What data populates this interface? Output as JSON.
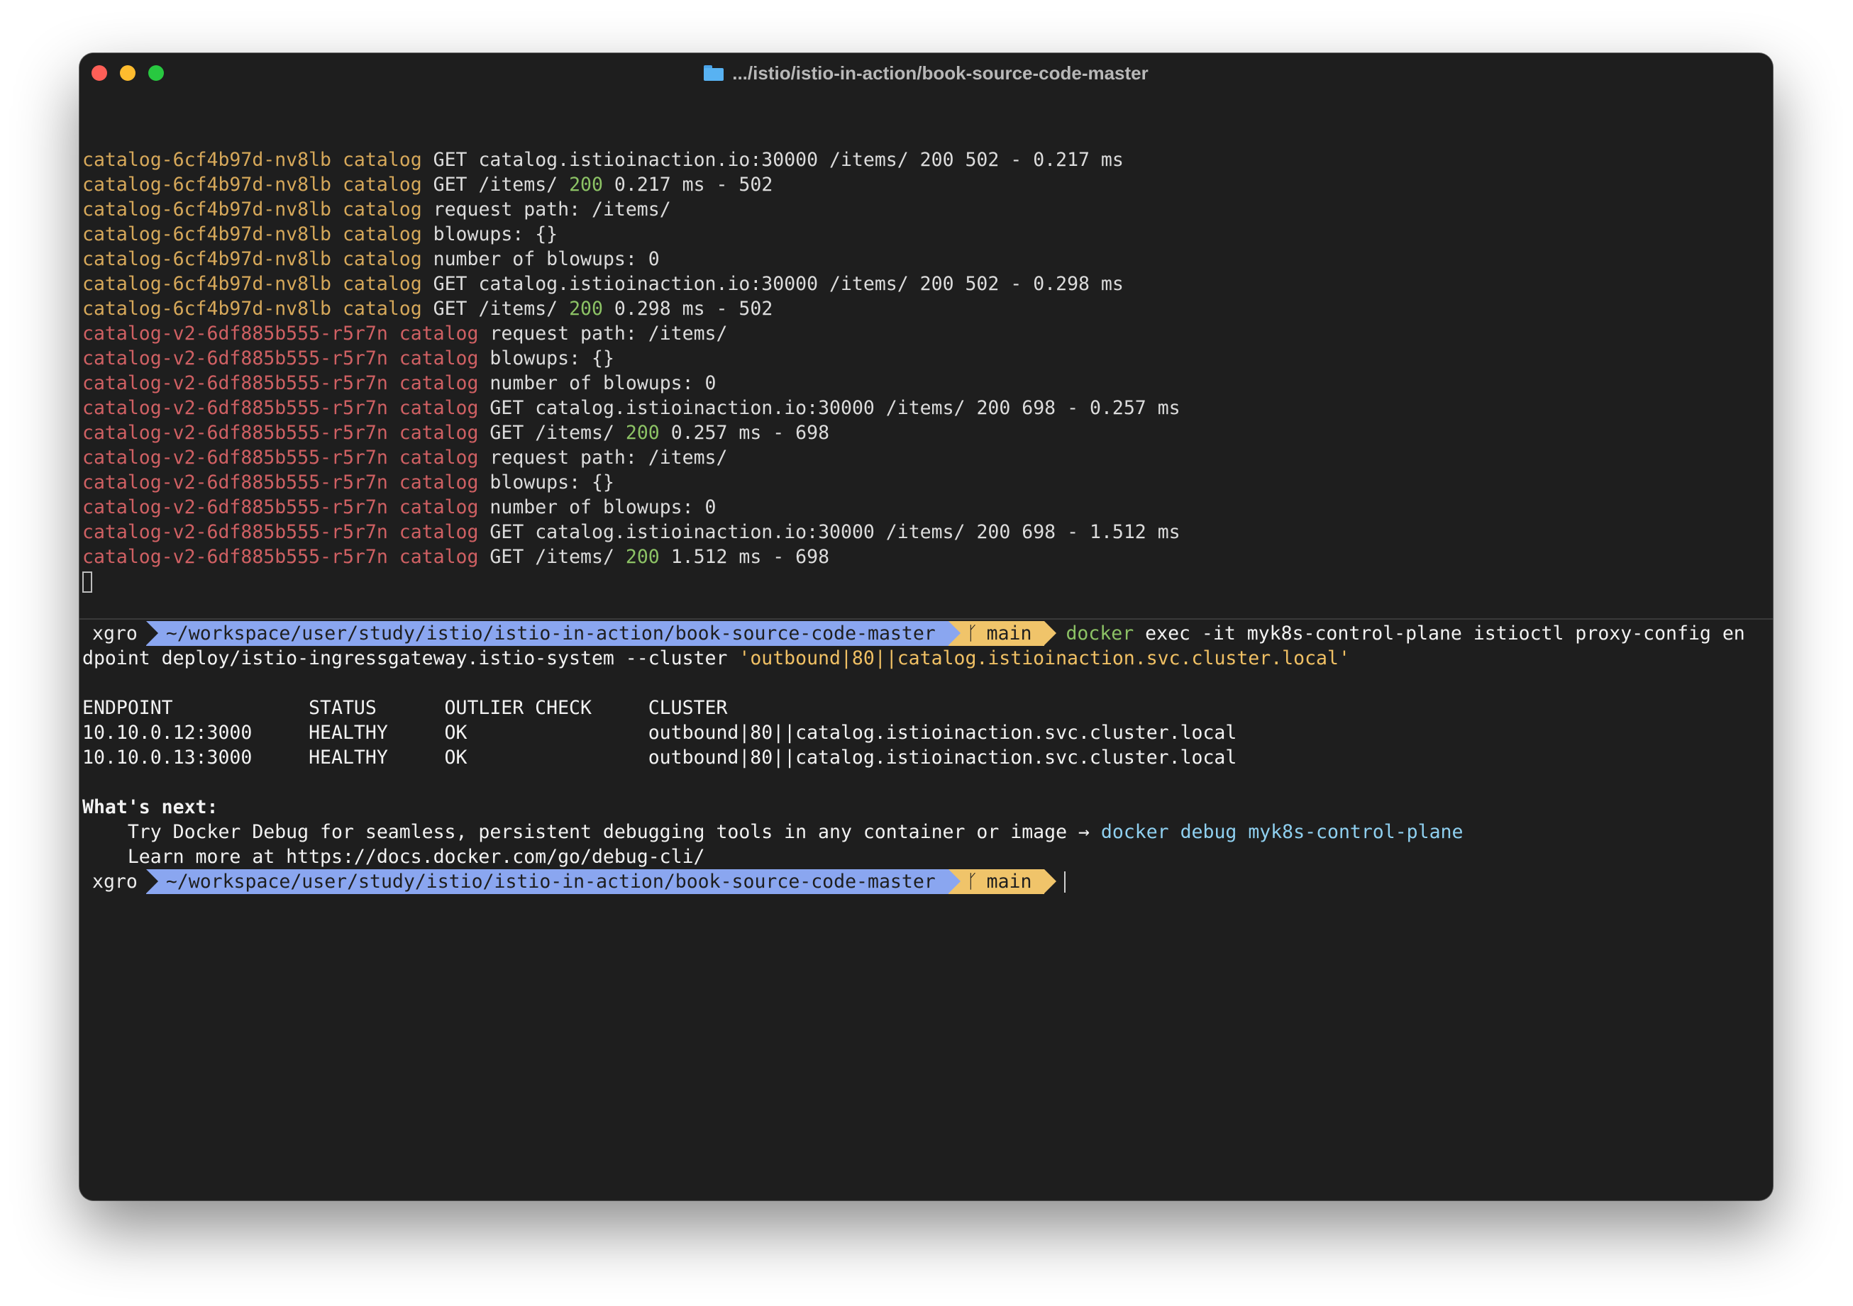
{
  "window": {
    "title": ".../istio/istio-in-action/book-source-code-master"
  },
  "logs": [
    {
      "pod": "catalog-6cf4b97d-nv8lb",
      "container": "catalog",
      "msg": "GET catalog.istioinaction.io:30000 /items/ 200 502 - 0.217 ms"
    },
    {
      "pod": "catalog-6cf4b97d-nv8lb",
      "container": "catalog",
      "pre": "GET /items/ ",
      "status": "200",
      "post": " 0.217 ms - 502"
    },
    {
      "pod": "catalog-6cf4b97d-nv8lb",
      "container": "catalog",
      "msg": "request path: /items/"
    },
    {
      "pod": "catalog-6cf4b97d-nv8lb",
      "container": "catalog",
      "msg": "blowups: {}"
    },
    {
      "pod": "catalog-6cf4b97d-nv8lb",
      "container": "catalog",
      "msg": "number of blowups: 0"
    },
    {
      "pod": "catalog-6cf4b97d-nv8lb",
      "container": "catalog",
      "msg": "GET catalog.istioinaction.io:30000 /items/ 200 502 - 0.298 ms"
    },
    {
      "pod": "catalog-6cf4b97d-nv8lb",
      "container": "catalog",
      "pre": "GET /items/ ",
      "status": "200",
      "post": " 0.298 ms - 502"
    },
    {
      "pod": "catalog-v2-6df885b555-r5r7n",
      "container": "catalog",
      "msg": "request path: /items/"
    },
    {
      "pod": "catalog-v2-6df885b555-r5r7n",
      "container": "catalog",
      "msg": "blowups: {}"
    },
    {
      "pod": "catalog-v2-6df885b555-r5r7n",
      "container": "catalog",
      "msg": "number of blowups: 0"
    },
    {
      "pod": "catalog-v2-6df885b555-r5r7n",
      "container": "catalog",
      "msg": "GET catalog.istioinaction.io:30000 /items/ 200 698 - 0.257 ms"
    },
    {
      "pod": "catalog-v2-6df885b555-r5r7n",
      "container": "catalog",
      "pre": "GET /items/ ",
      "status": "200",
      "post": " 0.257 ms - 698"
    },
    {
      "pod": "catalog-v2-6df885b555-r5r7n",
      "container": "catalog",
      "msg": "request path: /items/"
    },
    {
      "pod": "catalog-v2-6df885b555-r5r7n",
      "container": "catalog",
      "msg": "blowups: {}"
    },
    {
      "pod": "catalog-v2-6df885b555-r5r7n",
      "container": "catalog",
      "msg": "number of blowups: 0"
    },
    {
      "pod": "catalog-v2-6df885b555-r5r7n",
      "container": "catalog",
      "msg": "GET catalog.istioinaction.io:30000 /items/ 200 698 - 1.512 ms"
    },
    {
      "pod": "catalog-v2-6df885b555-r5r7n",
      "container": "catalog",
      "pre": "GET /items/ ",
      "status": "200",
      "post": " 1.512 ms - 698"
    }
  ],
  "prompt": {
    "user": "xgro",
    "path": "~/workspace/user/study/istio/istio-in-action/book-source-code-master",
    "branch": "main"
  },
  "command": {
    "program": "docker",
    "args_line1": " exec -it myk8s-control-plane istioctl proxy-config en",
    "args_line2": "dpoint deploy/istio-ingressgateway.istio-system --cluster ",
    "quoted": "'outbound|80||catalog.istioinaction.svc.cluster.local'"
  },
  "output_table": {
    "header": "ENDPOINT            STATUS      OUTLIER CHECK     CLUSTER",
    "rows": [
      "10.10.0.12:3000     HEALTHY     OK                outbound|80||catalog.istioinaction.svc.cluster.local",
      "10.10.0.13:3000     HEALTHY     OK                outbound|80||catalog.istioinaction.svc.cluster.local"
    ]
  },
  "whats_next": {
    "heading": "What's next:",
    "tip_text": "    Try Docker Debug for seamless, persistent debugging tools in any container or image → ",
    "tip_command": "docker debug myk8s-control-plane",
    "learn_more": "    Learn more at https://docs.docker.com/go/debug-cli/"
  },
  "colors": {
    "background": "#1e1e1e",
    "pod_v1": "#d6a85a",
    "pod_v2": "#cf6063",
    "status_ok": "#8cc265",
    "path_segment": "#8aa6f0",
    "git_segment": "#f0c46a",
    "string": "#f0c064",
    "hint_command": "#8fd0f0"
  },
  "icons": {
    "folder": "folder-icon",
    "branch": "git-branch-icon"
  }
}
